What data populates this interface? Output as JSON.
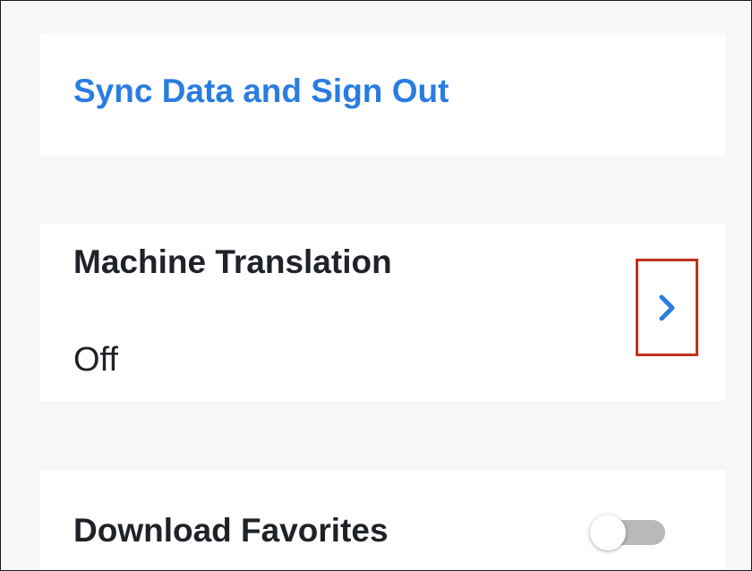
{
  "sync_card": {
    "label": "Sync Data and Sign Out"
  },
  "machine_translation": {
    "title": "Machine Translation",
    "value": "Off",
    "chevron_icon": "chevron-right"
  },
  "download_favorites": {
    "title": "Download Favorites",
    "toggle_on": false
  },
  "colors": {
    "accent": "#2a7de0",
    "highlight_box": "#c0321f",
    "text": "#1f2328",
    "background": "#f7f7f7",
    "card": "#ffffff",
    "toggle_track_off": "#b9b9b9"
  }
}
